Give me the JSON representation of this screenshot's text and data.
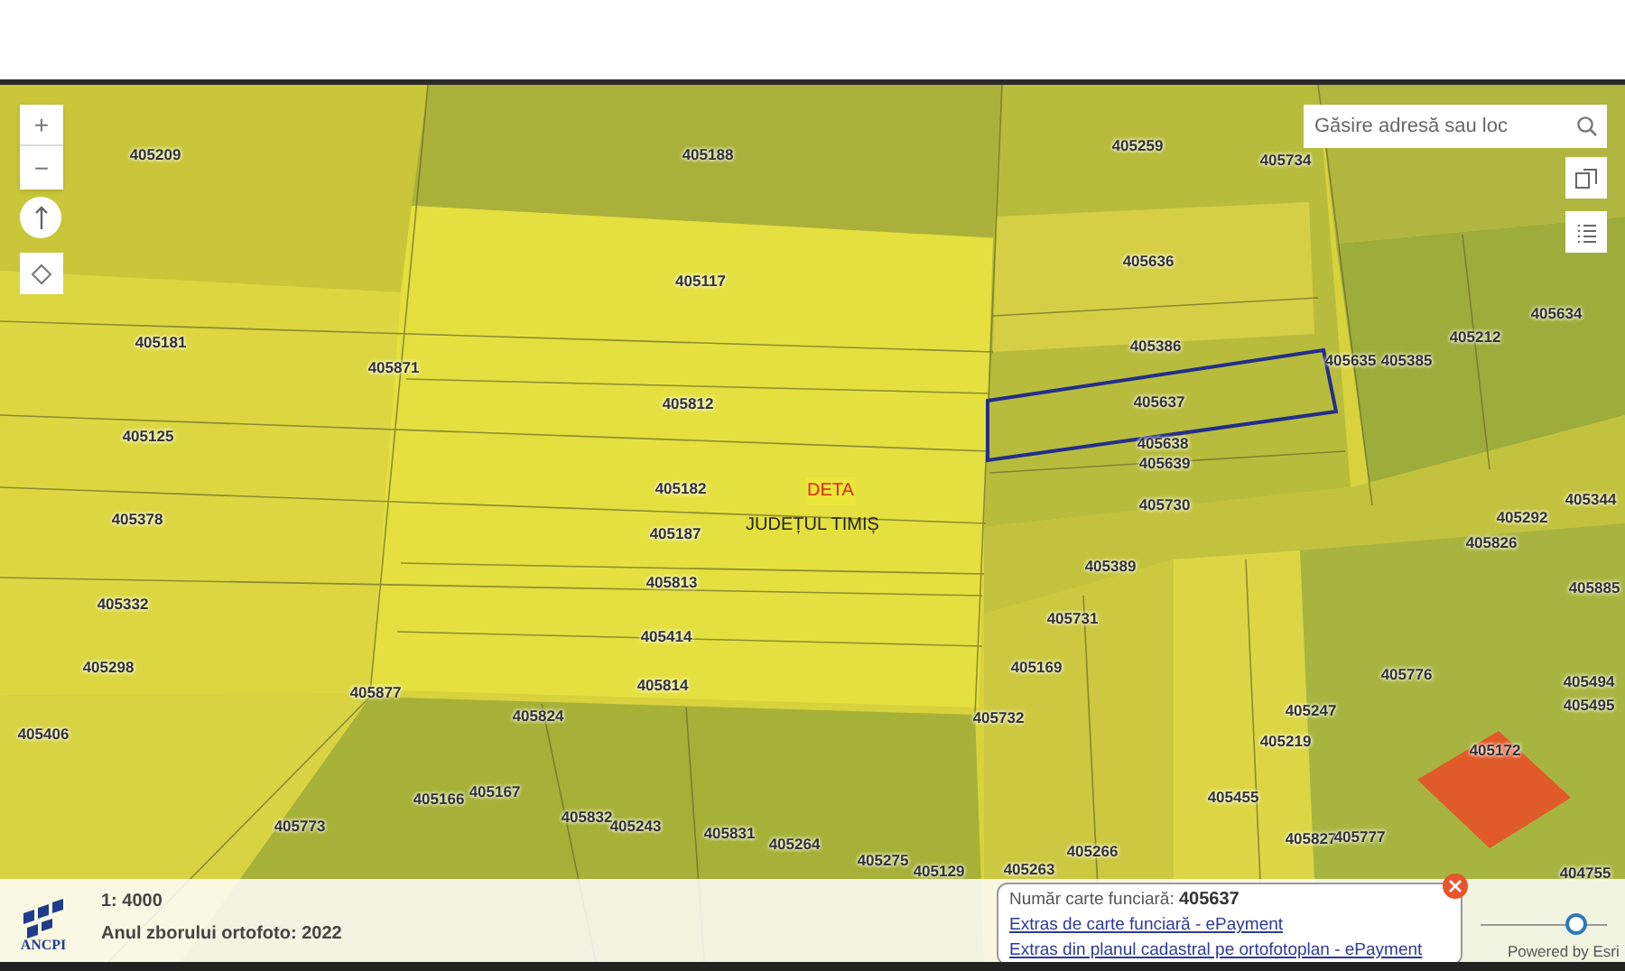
{
  "map": {
    "zoom_controls": [
      {
        "label": "+"
      },
      {
        "label": "−"
      }
    ],
    "search": {
      "placeholder": "Găsire adresă sau loc"
    },
    "parcels": [
      {
        "number": "405209"
      },
      {
        "number": "405188"
      },
      {
        "number": "405259"
      },
      {
        "number": "405734"
      },
      {
        "number": "405117"
      },
      {
        "number": "405636"
      },
      {
        "number": "405634"
      },
      {
        "number": "405181"
      },
      {
        "number": "405871"
      },
      {
        "number": "405386"
      },
      {
        "number": "405212"
      },
      {
        "number": "405635"
      },
      {
        "number": "405385"
      },
      {
        "number": "405812"
      },
      {
        "number": "405637"
      },
      {
        "number": "405125"
      },
      {
        "number": "405638"
      },
      {
        "number": "405639"
      },
      {
        "number": "405182"
      },
      {
        "number": "405344"
      },
      {
        "number": "405378"
      },
      {
        "number": "405730"
      },
      {
        "number": "405292"
      },
      {
        "number": "405187"
      },
      {
        "number": "405826"
      },
      {
        "number": "405813"
      },
      {
        "number": "405389"
      },
      {
        "number": "405885"
      },
      {
        "number": "405332"
      },
      {
        "number": "405731"
      },
      {
        "number": "405414"
      },
      {
        "number": "405298"
      },
      {
        "number": "405169"
      },
      {
        "number": "405776"
      },
      {
        "number": "405494"
      },
      {
        "number": "405877"
      },
      {
        "number": "405814"
      },
      {
        "number": "405495"
      },
      {
        "number": "405824"
      },
      {
        "number": "405732"
      },
      {
        "number": "405247"
      },
      {
        "number": "405172"
      },
      {
        "number": "405406"
      },
      {
        "number": "405219"
      },
      {
        "number": "405166"
      },
      {
        "number": "405167"
      },
      {
        "number": "405455"
      },
      {
        "number": "405773"
      },
      {
        "number": "405832"
      },
      {
        "number": "405243"
      },
      {
        "number": "405831"
      },
      {
        "number": "405264"
      },
      {
        "number": "405827"
      },
      {
        "number": "405777"
      },
      {
        "number": "405275"
      },
      {
        "number": "405129"
      },
      {
        "number": "405263"
      },
      {
        "number": "405266"
      },
      {
        "number": "404755"
      }
    ],
    "place_labels": [
      {
        "text": "DETA",
        "kind": "locality"
      },
      {
        "text": "JUDEȚUL TIMIȘ",
        "kind": "county"
      }
    ]
  },
  "footer": {
    "logo_text": "ANCPI",
    "scale": "1: 4000",
    "ortho_year": "Anul zborului ortofoto: 2022",
    "popup": {
      "label": "Număr carte funciară:",
      "value": "405637",
      "links": [
        "Extras de carte funciară - ePayment",
        "Extras din planul cadastral pe ortofotoplan - ePayment"
      ]
    },
    "slider": {
      "level": 0.75
    },
    "attribution": "Powered by Esri"
  }
}
